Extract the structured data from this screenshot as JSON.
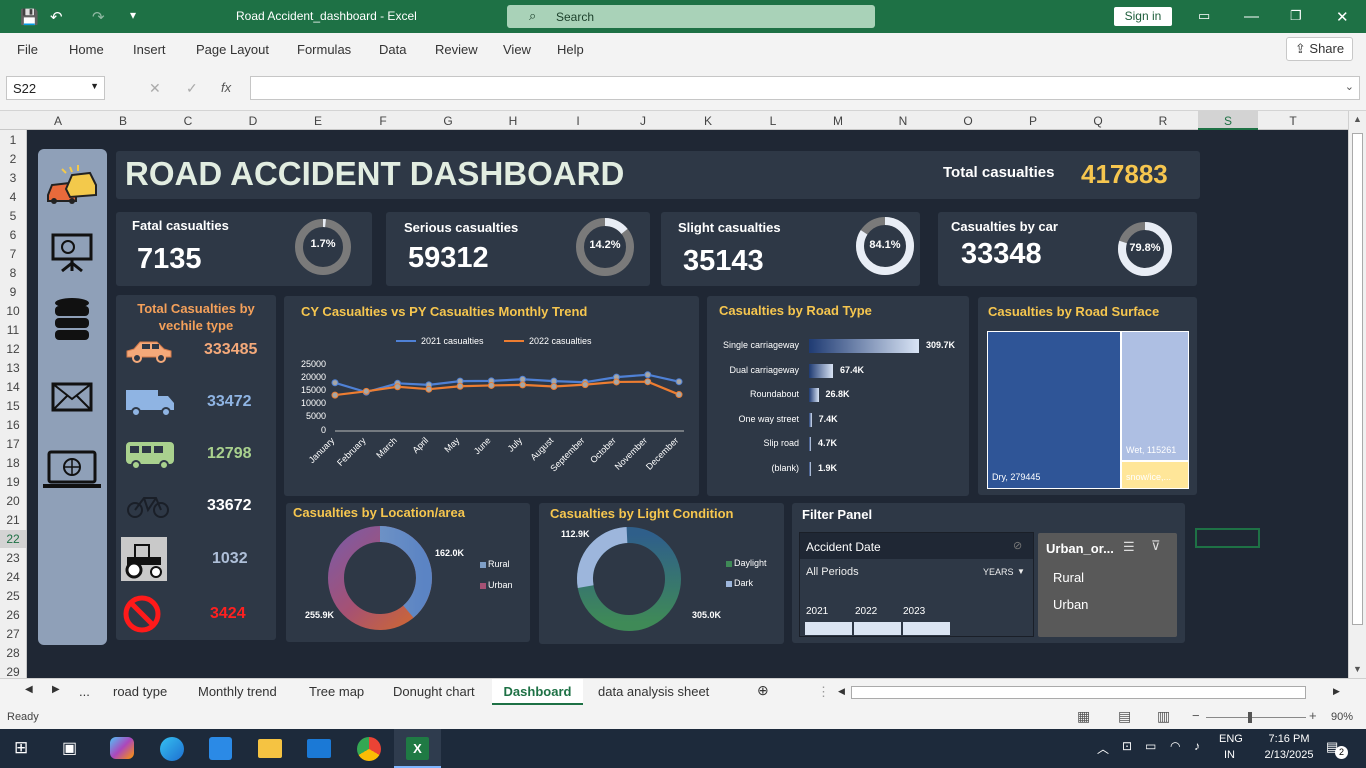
{
  "window": {
    "title": "Road Accident_dashboard  -  Excel",
    "search_placeholder": "Search",
    "signin": "Sign in"
  },
  "menu": [
    "File",
    "Home",
    "Insert",
    "Page Layout",
    "Formulas",
    "Data",
    "Review",
    "View",
    "Help"
  ],
  "share_label": "Share",
  "formula_bar": {
    "name_box": "S22",
    "fx": "fx",
    "value": ""
  },
  "columns": [
    "A",
    "B",
    "C",
    "D",
    "E",
    "F",
    "G",
    "H",
    "I",
    "J",
    "K",
    "L",
    "M",
    "N",
    "O",
    "P",
    "Q",
    "R",
    "S",
    "T"
  ],
  "rows": [
    "1",
    "2",
    "3",
    "4",
    "5",
    "6",
    "7",
    "8",
    "9",
    "10",
    "11",
    "12",
    "13",
    "14",
    "15",
    "16",
    "17",
    "18",
    "19",
    "20",
    "21",
    "22",
    "23",
    "24",
    "25",
    "26",
    "27",
    "28",
    "29"
  ],
  "dashboard": {
    "title": "ROAD ACCIDENT DASHBOARD",
    "total_label": "Total casualties",
    "total_value": "417883",
    "kpis": [
      {
        "label": "Fatal casualties",
        "value": "7135",
        "pct": "1.7%",
        "fraction": 0.017
      },
      {
        "label": "Serious casualties",
        "value": "59312",
        "pct": "14.2%",
        "fraction": 0.142
      },
      {
        "label": "Slight casualties",
        "value": "35143",
        "pct": "84.1%",
        "fraction": 0.841
      },
      {
        "label": "Casualties by car",
        "value": "33348",
        "pct": "79.8%",
        "fraction": 0.798
      }
    ],
    "vehicle_panel": {
      "title_line1": "Total Casualties by",
      "title_line2": "vechile type",
      "items": [
        {
          "icon": "car-icon",
          "value": "333485",
          "color": "#f4a97a"
        },
        {
          "icon": "truck-icon",
          "value": "33472",
          "color": "#8fb4e3"
        },
        {
          "icon": "bus-icon",
          "value": "12798",
          "color": "#a9d18e"
        },
        {
          "icon": "bicycle-icon",
          "value": "33672",
          "color": "#ffffff"
        },
        {
          "icon": "tractor-icon",
          "value": "1032",
          "color": "#aebfd8"
        },
        {
          "icon": "no-entry-icon",
          "value": "3424",
          "color": "#ff2020"
        }
      ]
    },
    "trend": {
      "title": "CY Casualties vs PY Casualties Monthly Trend",
      "legend": [
        "2021 casualties",
        "2022 casualties"
      ],
      "y_ticks": [
        "25000",
        "20000",
        "15000",
        "10000",
        "5000",
        "0"
      ]
    },
    "road_type": {
      "title": "Casualties by Road Type",
      "items": [
        {
          "label": "Single carriageway",
          "value": "309.7K",
          "num": 309.7
        },
        {
          "label": "Dual carriageway",
          "value": "67.4K",
          "num": 67.4
        },
        {
          "label": "Roundabout",
          "value": "26.8K",
          "num": 26.8
        },
        {
          "label": "One way street",
          "value": "7.4K",
          "num": 7.4
        },
        {
          "label": "Slip road",
          "value": "4.7K",
          "num": 4.7
        },
        {
          "label": "(blank)",
          "value": "1.9K",
          "num": 1.9
        }
      ]
    },
    "road_surface": {
      "title": "Casualties by Road Surface",
      "dry": "Dry, 279445",
      "wet": "Wet, 115261",
      "snow": "snow/ice,..."
    },
    "location": {
      "title": "Casualties by Location/area",
      "rural_value": "162.0K",
      "urban_value": "255.9K",
      "legend": [
        "Rural",
        "Urban"
      ]
    },
    "light": {
      "title": "Casualties by Light Condition",
      "dark_value": "112.9K",
      "day_value": "305.0K",
      "legend": [
        "Daylight",
        "Dark"
      ]
    },
    "filter": {
      "title": "Filter Panel",
      "timeline_title": "Accident Date",
      "all_periods": "All Periods",
      "unit": "YEARS",
      "years": [
        "2021",
        "2022",
        "2023"
      ],
      "slicer_title": "Urban_or...",
      "slicer_items": [
        "Rural",
        "Urban"
      ]
    }
  },
  "chart_data": {
    "type": "line",
    "title": "CY Casualties vs PY Casualties Monthly Trend",
    "categories": [
      "January",
      "February",
      "March",
      "April",
      "May",
      "June",
      "July",
      "August",
      "September",
      "October",
      "November",
      "December"
    ],
    "series": [
      {
        "name": "2021 casualties",
        "values": [
          18000,
          14500,
          17800,
          17200,
          18600,
          18700,
          19300,
          18600,
          18200,
          20100,
          21000,
          18400
        ]
      },
      {
        "name": "2022 casualties",
        "values": [
          13400,
          14800,
          16500,
          15600,
          16700,
          17000,
          17200,
          16600,
          17300,
          18300,
          18400,
          13600
        ]
      }
    ],
    "ylim": [
      0,
      25000
    ]
  },
  "tabs": [
    "...",
    "road type",
    "Monthly trend",
    "Tree map",
    "Donught chart",
    "Dashboard",
    "data analysis sheet"
  ],
  "active_tab": "Dashboard",
  "status": {
    "ready": "Ready",
    "zoom": "90%"
  },
  "taskbar": {
    "lang": "ENG",
    "region": "IN",
    "time": "7:16 PM",
    "date": "2/13/2025",
    "badge": "2"
  }
}
